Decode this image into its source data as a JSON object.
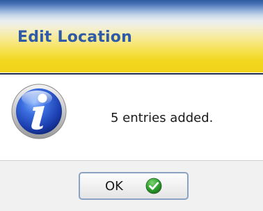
{
  "dialog": {
    "title": "Edit Location",
    "message": "5 entries added.",
    "icon": "info-icon",
    "ok_button": {
      "label": "OK",
      "icon": "check-circle-icon"
    }
  },
  "colors": {
    "title_text": "#2f5aa8",
    "title_gradient_top": "#2c5aa0",
    "title_gradient_bottom": "#f0d31a",
    "info_icon": "#2a55c8",
    "check_icon": "#2e9e2e"
  }
}
